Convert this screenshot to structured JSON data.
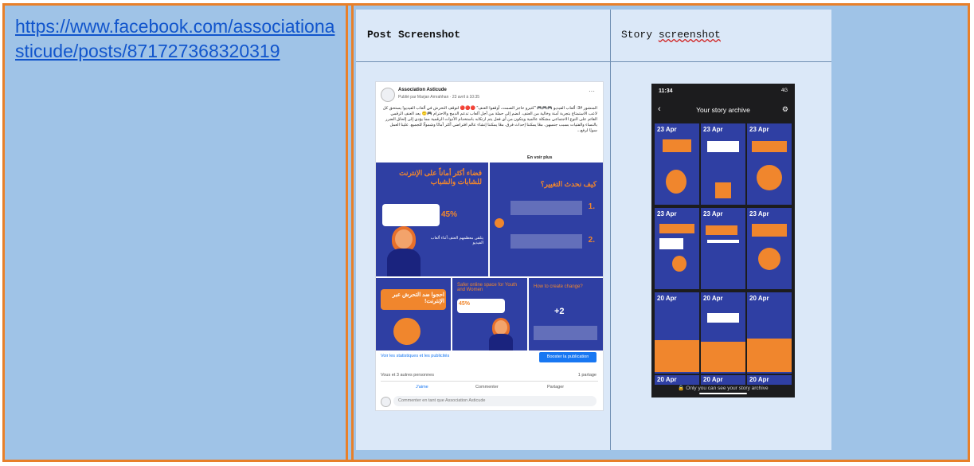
{
  "link": {
    "text": "https://www.facebook.com/associationasticude/posts/871727368320319"
  },
  "columns": {
    "post_title": "Post Screenshot",
    "story_title_a": "Story ",
    "story_title_b": "screenshot"
  },
  "post": {
    "page_name": "Association Asticude",
    "published": "Publié par Marjan Amrahhan · 23 avril à 10:35",
    "more": "···",
    "body": "المنشور #3: ألعاب الفيديو 🎮🎮🎮 \"كتيرو حاجز الصمت، أوقفوا العنف\" 🔴🔴🔴 لتوقف التحرش في ألعاب الفيديو! يستحق كل لاعب الاستمتاع بتجربة آمنة وخالية من العنف. انضم إلى حملة من أجل ألعاب تدعم الدمج والاحترام 🎮🙂 يعد العنف الرقمي القائم على النوع الاجتماعي مشكلة عالمية ويتكون من أي فعل يتم ارتكابه باستخدام الأدوات الرقمية مما يؤدي إلى إلحاق الضرر بالنساء والفتيات بسبب جنسهن. معًا يمكننا إحداث فرق. معًا يمكننا إنشاء عالم افتراضي أكثر أمانًا وشمولًا للجميع. علينا العمل سويًا لرفع...",
    "see_more": "En voir plus",
    "tiles": {
      "a_title": "فضاء أكثر أماناً على الإنترنت للشابات والشباب",
      "a_pct": "45%",
      "a_note": "يتلقى معظمهم العنف أثناء ألعاب الفيديو",
      "b_title": "كيف نحدث التغيير؟",
      "b_1": "1.",
      "b_2": "2.",
      "c_title": "احجوا ضد التحرش عبر الإنترنت!",
      "d_title": "Safer online space for Youth and Women",
      "d_pct": "45%",
      "e_title": "How to create change?",
      "e_plus": "+2"
    },
    "stats_link": "Voir les statistiques et les publicités",
    "boost": "Booster la publication",
    "reactions": "Vous et 3 autres personnes",
    "shares": "1 partage",
    "like": "J'aime",
    "comment": "Commenter",
    "share": "Partager",
    "comment_placeholder": "Commenter en tant que Association Asticude"
  },
  "story": {
    "time": "11:34",
    "signal": "4G",
    "title": "Your story archive",
    "tiles": [
      "23 Apr",
      "23 Apr",
      "23 Apr",
      "23 Apr",
      "23 Apr",
      "23 Apr",
      "20 Apr",
      "20 Apr",
      "20 Apr",
      "20 Apr",
      "20 Apr",
      "20 Apr"
    ],
    "footer": "Only you can see your story archive"
  },
  "colors": {
    "orange_border": "#e8802a",
    "cell_blue": "#9fc3e7",
    "brand_blue": "#2f3fa3",
    "accent_orange": "#f0862d"
  }
}
